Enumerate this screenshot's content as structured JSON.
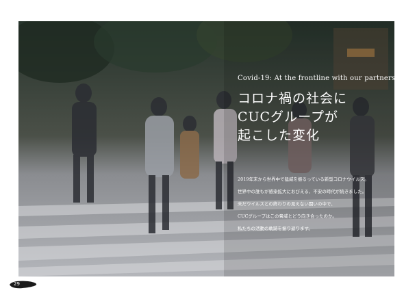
{
  "page": {
    "subtitle": "Covid-19: At the frontline with our partners",
    "title_lines": [
      "コロナ禍の社会に",
      "CUCグループが",
      "起こした変化"
    ],
    "body_lines": [
      "2019年末から世界中で猛威を振るっている新型コロナウイルス。",
      "世界中の誰もが感染拡大におびえる、不安の時代が続きました。",
      "未だウイルスとの終わりの見えない闘いの中で、",
      "CUCグループはこの脅威とどう向き合ったのか。",
      "私たちの活動の軌跡を振り返ります。"
    ],
    "page_number": "29"
  },
  "photo": {
    "description_icon": "crowd-crosswalk-photo"
  },
  "colors": {
    "text": "#ffffff",
    "badge": "#1a1a1a"
  }
}
